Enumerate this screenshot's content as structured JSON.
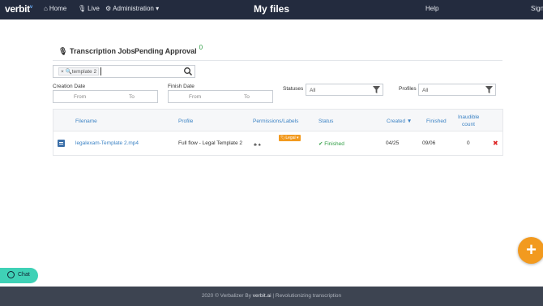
{
  "nav": {
    "logo": "verbit",
    "logo_mark": "v",
    "home": "Home",
    "live": "Live",
    "administration": "Administration",
    "title": "My files",
    "help": "Help",
    "sign": "Sign"
  },
  "tabs": {
    "transcription_jobs": "Transcription Jobs",
    "pending_approval": "Pending Approval",
    "pending_count": "0"
  },
  "search": {
    "chip_remove": "×",
    "chip_label": "template 2"
  },
  "filters": {
    "creation_date_label": "Creation Date",
    "finish_date_label": "Finish Date",
    "from": "From",
    "to": "To",
    "statuses_label": "Statuses",
    "statuses_value": "All",
    "profiles_label": "Profiles",
    "profiles_value": "All"
  },
  "table": {
    "columns": {
      "filename": "Filename",
      "profile": "Profile",
      "permissions": "Permissions/Labels",
      "status": "Status",
      "created": "Created ▼",
      "finished": "Finished",
      "inaudible_1": "Inaudible",
      "inaudible_2": "count"
    },
    "rows": [
      {
        "filename": "legalexam-Template 2.mp4",
        "profile": "Full flow - Legal Template 2",
        "label": "Legal",
        "perm_icons": "♣ ♠",
        "status": "✔ Finished",
        "created": "04/25",
        "finished": "09/06",
        "inaudible": "0",
        "delete": "✖"
      }
    ]
  },
  "fab": "+",
  "chat": "Chat",
  "footer": {
    "text": "2020 © Verbalizer By",
    "link": "verbit.ai",
    "tail": "| Revolutionizing transcription"
  },
  "colors": {
    "nav_bg": "#232b3e",
    "accent": "#3b82c4",
    "success": "#2e9d43",
    "orange": "#f29a1f",
    "chat": "#3fd1b6",
    "footer_bg": "#3d4451"
  }
}
